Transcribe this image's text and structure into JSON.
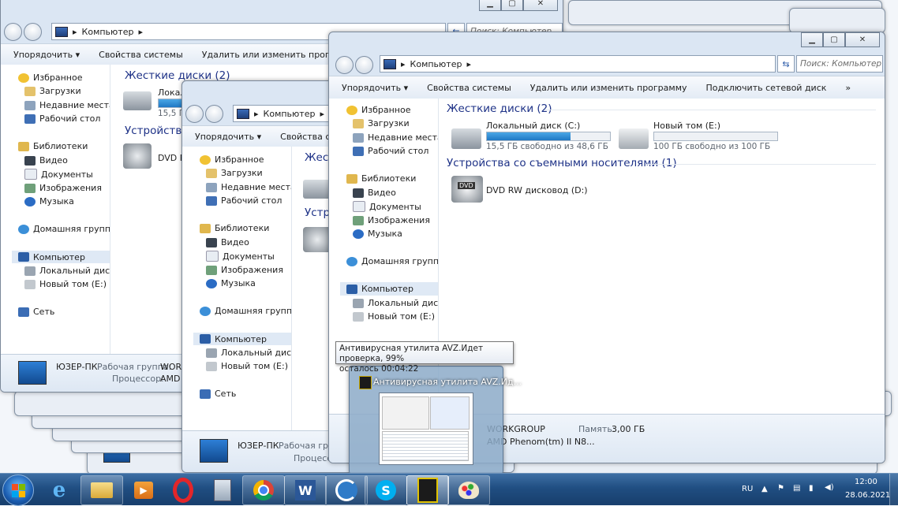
{
  "explorer": {
    "address": "Компьютер",
    "search_placeholder": "Поиск: Компьютер",
    "toolbar": {
      "organize": "Упорядочить",
      "system_properties": "Свойства системы",
      "uninstall": "Удалить или изменить программу",
      "map_drive": "Подключить сетевой диск",
      "more": "»",
      "truncated_item": "П"
    },
    "nav": {
      "favorites": "Избранное",
      "downloads": "Загрузки",
      "recent": "Недавние места",
      "desktop": "Рабочий стол",
      "libraries": "Библиотеки",
      "video": "Видео",
      "documents": "Документы",
      "images": "Изображения",
      "music": "Музыка",
      "homegroup": "Домашняя группа",
      "computer": "Компьютер",
      "local_disk": "Локальный диск (C",
      "new_volume": "Новый том (E:)",
      "network": "Сеть"
    },
    "sections": {
      "hard_disks": "Жесткие диски (2)",
      "removable": "Устройства со съемными носителями (1)",
      "hard_disks_cut": "Жестк",
      "removable_cut": "Устройства с",
      "removable_cut2": "Устро"
    },
    "drives": {
      "c_name": "Локальный диск (C:)",
      "c_name_cut": "Локальн",
      "c_free": "15,5 ГБ свободно из 48,6 ГБ",
      "c_free_cut": "15,5 ГБ",
      "c_used_fraction": 0.68,
      "e_name": "Новый том (E:)",
      "e_free": "100 ГБ свободно из 100 ГБ",
      "e_used_fraction": 0.0,
      "dvd_name": "DVD RW дисковод (D:)",
      "dvd_name_cut": "DVD RV",
      "dvd_label": "DVD"
    },
    "details": {
      "computer_name": "ЮЗЕР-ПК",
      "workgroup_label": "Рабочая группа:",
      "workgroup_value": "WORK",
      "workgroup_value_full": "WORKGROUP",
      "processor_label": "Процессор:",
      "processor_value": "AMD P",
      "processor_value_full": "AMD Phenom(tm) II N8...",
      "memory_label": "Память:",
      "memory_value": "3,00 ГБ",
      "win3_workgroup": "W",
      "win3_processor": "AM"
    }
  },
  "tooltip": {
    "line1": "Антивирусная утилита AVZ.Идет проверка, 99%",
    "line2": "осталось 00:04:22"
  },
  "thumbnail": {
    "title": "Антивирусная утилита AVZ.Ид..."
  },
  "taskbar": {
    "lang": "RU",
    "time": "12:00",
    "date": "28.06.2021"
  },
  "colors": {
    "accent": "#1e3287",
    "taskbar": "#204e82",
    "drive_fill": "#1f78c4"
  }
}
